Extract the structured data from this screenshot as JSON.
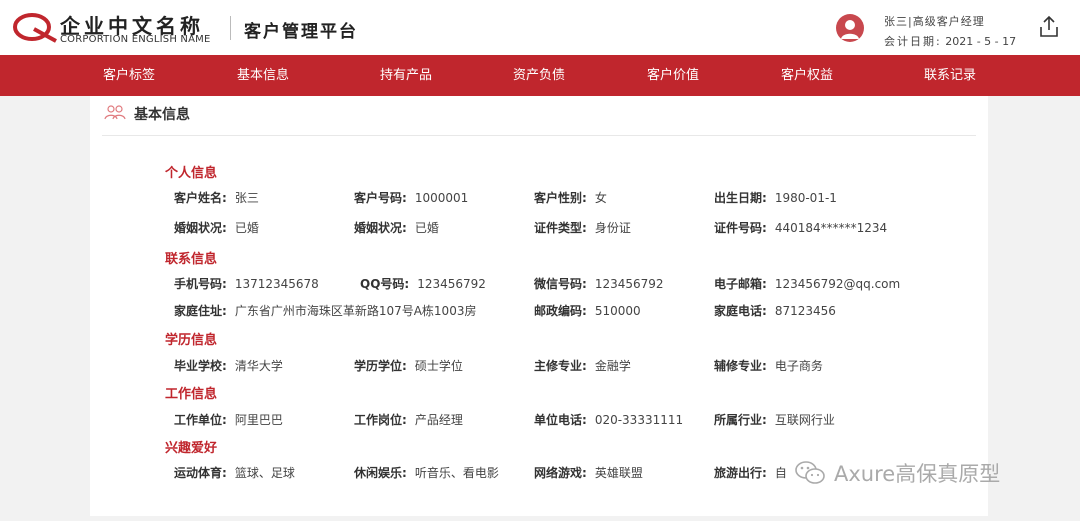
{
  "header": {
    "company_cn": "企业中文名称",
    "company_en": "CORPORTION ENGLISH NAME",
    "platform_title": "客户管理平台",
    "user_line": "张三|高级客户经理",
    "date_label": "会计日期:",
    "date_value": "2021 - 5 - 17",
    "logo_icon": "company-logo-icon",
    "share_icon": "share-icon"
  },
  "nav": {
    "items": [
      {
        "label": "客户标签"
      },
      {
        "label": "基本信息"
      },
      {
        "label": "持有产品"
      },
      {
        "label": "资产负债"
      },
      {
        "label": "客户价值"
      },
      {
        "label": "客户权益"
      },
      {
        "label": "联系记录"
      }
    ]
  },
  "card": {
    "title": "基本信息",
    "icon": "people-icon"
  },
  "sections": {
    "personal": {
      "title": "个人信息",
      "rows": [
        [
          {
            "k": "客户姓名:",
            "v": "张三"
          },
          {
            "k": "客户号码:",
            "v": "1000001"
          },
          {
            "k": "客户性别:",
            "v": "女"
          },
          {
            "k": "出生日期:",
            "v": "1980-01-1"
          }
        ],
        [
          {
            "k": "婚姻状况:",
            "v": "已婚"
          },
          {
            "k": "婚姻状况:",
            "v": "已婚"
          },
          {
            "k": "证件类型:",
            "v": "身份证"
          },
          {
            "k": "证件号码:",
            "v": "440184******1234"
          }
        ]
      ]
    },
    "contact": {
      "title": "联系信息",
      "rows": [
        [
          {
            "k": "手机号码:",
            "v": "13712345678"
          },
          {
            "k": "QQ号码:",
            "v": "123456792"
          },
          {
            "k": "微信号码:",
            "v": "123456792"
          },
          {
            "k": "电子邮箱:",
            "v": "123456792@qq.com"
          }
        ],
        [
          {
            "k": "家庭住址:",
            "v": "广东省广州市海珠区革新路107号A栋1003房"
          },
          {
            "k": "邮政编码:",
            "v": "510000"
          },
          {
            "k": "家庭电话:",
            "v": "87123456"
          }
        ]
      ]
    },
    "education": {
      "title": "学历信息",
      "rows": [
        [
          {
            "k": "毕业学校:",
            "v": "清华大学"
          },
          {
            "k": "学历学位:",
            "v": "硕士学位"
          },
          {
            "k": "主修专业:",
            "v": "金融学"
          },
          {
            "k": "辅修专业:",
            "v": "电子商务"
          }
        ]
      ]
    },
    "work": {
      "title": "工作信息",
      "rows": [
        [
          {
            "k": "工作单位:",
            "v": "阿里巴巴"
          },
          {
            "k": "工作岗位:",
            "v": "产品经理"
          },
          {
            "k": "单位电话:",
            "v": "020-33331111"
          },
          {
            "k": "所属行业:",
            "v": "互联网行业"
          }
        ]
      ]
    },
    "hobby": {
      "title": "兴趣爱好",
      "rows": [
        [
          {
            "k": "运动体育:",
            "v": "篮球、足球"
          },
          {
            "k": "休闲娱乐:",
            "v": "听音乐、看电影"
          },
          {
            "k": "网络游戏:",
            "v": "英雄联盟"
          },
          {
            "k": "旅游出行:",
            "v": "自"
          }
        ]
      ]
    }
  },
  "watermark": {
    "text": "Axure高保真原型",
    "icon": "wechat-icon"
  },
  "colors": {
    "brand_red": "#c0262d",
    "page_bg": "#f2f2f2"
  }
}
